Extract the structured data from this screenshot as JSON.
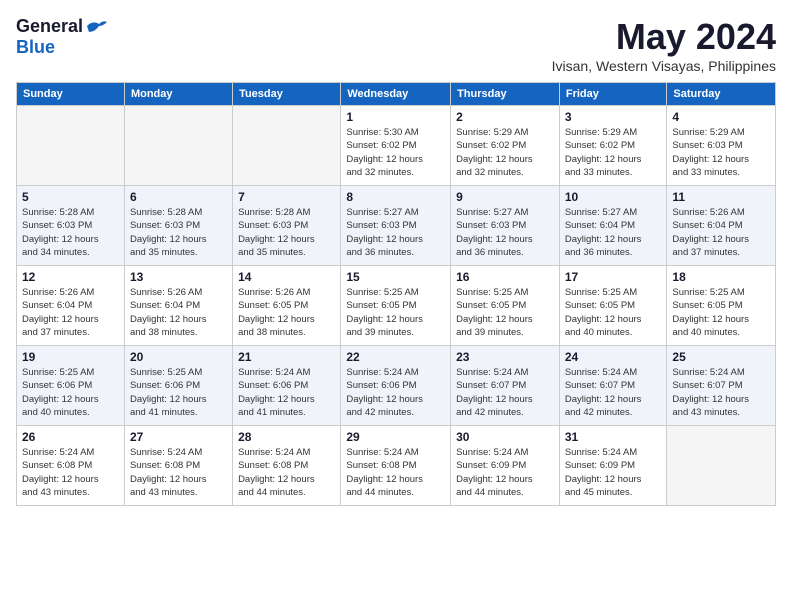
{
  "header": {
    "logo_general": "General",
    "logo_blue": "Blue",
    "month": "May 2024",
    "location": "Ivisan, Western Visayas, Philippines"
  },
  "columns": [
    "Sunday",
    "Monday",
    "Tuesday",
    "Wednesday",
    "Thursday",
    "Friday",
    "Saturday"
  ],
  "weeks": [
    {
      "shaded": false,
      "days": [
        {
          "num": "",
          "info": ""
        },
        {
          "num": "",
          "info": ""
        },
        {
          "num": "",
          "info": ""
        },
        {
          "num": "1",
          "info": "Sunrise: 5:30 AM\nSunset: 6:02 PM\nDaylight: 12 hours\nand 32 minutes."
        },
        {
          "num": "2",
          "info": "Sunrise: 5:29 AM\nSunset: 6:02 PM\nDaylight: 12 hours\nand 32 minutes."
        },
        {
          "num": "3",
          "info": "Sunrise: 5:29 AM\nSunset: 6:02 PM\nDaylight: 12 hours\nand 33 minutes."
        },
        {
          "num": "4",
          "info": "Sunrise: 5:29 AM\nSunset: 6:03 PM\nDaylight: 12 hours\nand 33 minutes."
        }
      ]
    },
    {
      "shaded": true,
      "days": [
        {
          "num": "5",
          "info": "Sunrise: 5:28 AM\nSunset: 6:03 PM\nDaylight: 12 hours\nand 34 minutes."
        },
        {
          "num": "6",
          "info": "Sunrise: 5:28 AM\nSunset: 6:03 PM\nDaylight: 12 hours\nand 35 minutes."
        },
        {
          "num": "7",
          "info": "Sunrise: 5:28 AM\nSunset: 6:03 PM\nDaylight: 12 hours\nand 35 minutes."
        },
        {
          "num": "8",
          "info": "Sunrise: 5:27 AM\nSunset: 6:03 PM\nDaylight: 12 hours\nand 36 minutes."
        },
        {
          "num": "9",
          "info": "Sunrise: 5:27 AM\nSunset: 6:03 PM\nDaylight: 12 hours\nand 36 minutes."
        },
        {
          "num": "10",
          "info": "Sunrise: 5:27 AM\nSunset: 6:04 PM\nDaylight: 12 hours\nand 36 minutes."
        },
        {
          "num": "11",
          "info": "Sunrise: 5:26 AM\nSunset: 6:04 PM\nDaylight: 12 hours\nand 37 minutes."
        }
      ]
    },
    {
      "shaded": false,
      "days": [
        {
          "num": "12",
          "info": "Sunrise: 5:26 AM\nSunset: 6:04 PM\nDaylight: 12 hours\nand 37 minutes."
        },
        {
          "num": "13",
          "info": "Sunrise: 5:26 AM\nSunset: 6:04 PM\nDaylight: 12 hours\nand 38 minutes."
        },
        {
          "num": "14",
          "info": "Sunrise: 5:26 AM\nSunset: 6:05 PM\nDaylight: 12 hours\nand 38 minutes."
        },
        {
          "num": "15",
          "info": "Sunrise: 5:25 AM\nSunset: 6:05 PM\nDaylight: 12 hours\nand 39 minutes."
        },
        {
          "num": "16",
          "info": "Sunrise: 5:25 AM\nSunset: 6:05 PM\nDaylight: 12 hours\nand 39 minutes."
        },
        {
          "num": "17",
          "info": "Sunrise: 5:25 AM\nSunset: 6:05 PM\nDaylight: 12 hours\nand 40 minutes."
        },
        {
          "num": "18",
          "info": "Sunrise: 5:25 AM\nSunset: 6:05 PM\nDaylight: 12 hours\nand 40 minutes."
        }
      ]
    },
    {
      "shaded": true,
      "days": [
        {
          "num": "19",
          "info": "Sunrise: 5:25 AM\nSunset: 6:06 PM\nDaylight: 12 hours\nand 40 minutes."
        },
        {
          "num": "20",
          "info": "Sunrise: 5:25 AM\nSunset: 6:06 PM\nDaylight: 12 hours\nand 41 minutes."
        },
        {
          "num": "21",
          "info": "Sunrise: 5:24 AM\nSunset: 6:06 PM\nDaylight: 12 hours\nand 41 minutes."
        },
        {
          "num": "22",
          "info": "Sunrise: 5:24 AM\nSunset: 6:06 PM\nDaylight: 12 hours\nand 42 minutes."
        },
        {
          "num": "23",
          "info": "Sunrise: 5:24 AM\nSunset: 6:07 PM\nDaylight: 12 hours\nand 42 minutes."
        },
        {
          "num": "24",
          "info": "Sunrise: 5:24 AM\nSunset: 6:07 PM\nDaylight: 12 hours\nand 42 minutes."
        },
        {
          "num": "25",
          "info": "Sunrise: 5:24 AM\nSunset: 6:07 PM\nDaylight: 12 hours\nand 43 minutes."
        }
      ]
    },
    {
      "shaded": false,
      "days": [
        {
          "num": "26",
          "info": "Sunrise: 5:24 AM\nSunset: 6:08 PM\nDaylight: 12 hours\nand 43 minutes."
        },
        {
          "num": "27",
          "info": "Sunrise: 5:24 AM\nSunset: 6:08 PM\nDaylight: 12 hours\nand 43 minutes."
        },
        {
          "num": "28",
          "info": "Sunrise: 5:24 AM\nSunset: 6:08 PM\nDaylight: 12 hours\nand 44 minutes."
        },
        {
          "num": "29",
          "info": "Sunrise: 5:24 AM\nSunset: 6:08 PM\nDaylight: 12 hours\nand 44 minutes."
        },
        {
          "num": "30",
          "info": "Sunrise: 5:24 AM\nSunset: 6:09 PM\nDaylight: 12 hours\nand 44 minutes."
        },
        {
          "num": "31",
          "info": "Sunrise: 5:24 AM\nSunset: 6:09 PM\nDaylight: 12 hours\nand 45 minutes."
        },
        {
          "num": "",
          "info": ""
        }
      ]
    }
  ]
}
